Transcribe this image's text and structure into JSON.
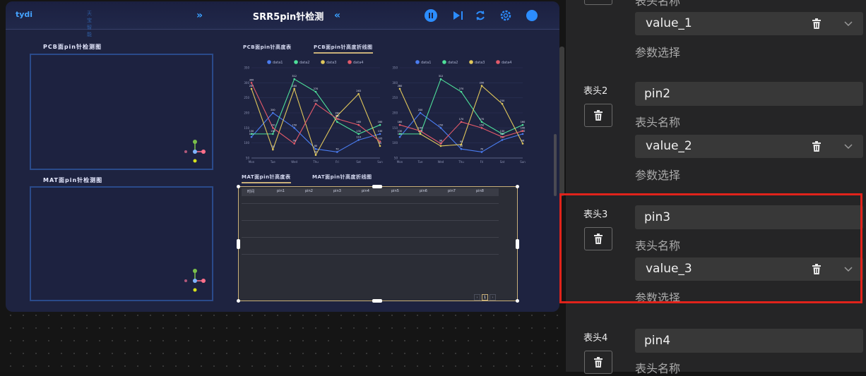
{
  "preview": {
    "logo": "tydi",
    "logo_sub": "天宝智能",
    "title": "SRR5pin针检测",
    "left_chevron": "»",
    "right_chevron": "«",
    "pcb_panel_title": "PCB面pin针检测图",
    "mat_panel_title": "MAT面pin针检测图",
    "tabs_top": [
      "PCB面pin针高度表",
      "PCB面pin针高度折线图"
    ],
    "tabs_bottom": [
      "MAT面pin针高度表",
      "MAT面pin针高度折线图"
    ],
    "table_headers": [
      "时间",
      "pin1",
      "pin2",
      "pin3",
      "pin4",
      "pin5",
      "pin6",
      "pin7",
      "pin8"
    ],
    "pager": {
      "prev": "‹",
      "page": "1",
      "next": "›"
    }
  },
  "chart_data": [
    {
      "type": "line",
      "legend": [
        "data1",
        "data2",
        "data3",
        "data4"
      ],
      "colors": [
        "#4a7cf0",
        "#4ee09a",
        "#e0c75b",
        "#e35a6a"
      ],
      "categories": [
        "Mon",
        "Tue",
        "Wed",
        "Thu",
        "Fri",
        "Sat",
        "Sun"
      ],
      "ylim": [
        50,
        350
      ],
      "yticks": [
        50,
        100,
        150,
        200,
        250,
        300,
        350
      ],
      "series": [
        {
          "name": "data1",
          "values": [
            120,
            200,
            150,
            80,
            70,
            110,
            130
          ]
        },
        {
          "name": "data2",
          "values": [
            130,
            130,
            312,
            270,
            170,
            130,
            160
          ]
        },
        {
          "name": "data3",
          "values": [
            280,
            78,
            280,
            60,
            190,
            263,
            90
          ]
        },
        {
          "name": "data4",
          "values": [
            300,
            150,
            98,
            230,
            180,
            160,
            105
          ]
        }
      ]
    },
    {
      "type": "line",
      "legend": [
        "data1",
        "data2",
        "data3",
        "data4"
      ],
      "colors": [
        "#4a7cf0",
        "#4ee09a",
        "#e0c75b",
        "#e35a6a"
      ],
      "categories": [
        "Mon",
        "Tue",
        "Wed",
        "Thu",
        "Fri",
        "Sat",
        "Sun"
      ],
      "ylim": [
        50,
        350
      ],
      "yticks": [
        50,
        100,
        150,
        200,
        250,
        300,
        350
      ],
      "series": [
        {
          "name": "data1",
          "values": [
            120,
            200,
            150,
            80,
            70,
            110,
            130
          ]
        },
        {
          "name": "data2",
          "values": [
            130,
            130,
            312,
            270,
            170,
            130,
            160
          ]
        },
        {
          "name": "data3",
          "values": [
            280,
            130,
            90,
            95,
            290,
            230,
            98
          ]
        },
        {
          "name": "data4",
          "values": [
            160,
            140,
            98,
            170,
            150,
            120,
            140
          ]
        }
      ]
    }
  ],
  "sidebar": {
    "rows": [
      {
        "label": "",
        "header_value": "",
        "header_sub": "",
        "param_value": "value_1",
        "param_sub": "参数选择"
      },
      {
        "label": "表头2",
        "header_value": "pin2",
        "header_sub": "表头名称",
        "param_value": "value_2",
        "param_sub": "参数选择"
      },
      {
        "label": "表头3",
        "header_value": "pin3",
        "header_sub": "表头名称",
        "param_value": "value_3",
        "param_sub": "参数选择"
      },
      {
        "label": "表头4",
        "header_value": "pin4",
        "header_sub": "表头名称",
        "param_value": "",
        "param_sub": ""
      }
    ],
    "partial_top_sub": "表头名称"
  }
}
